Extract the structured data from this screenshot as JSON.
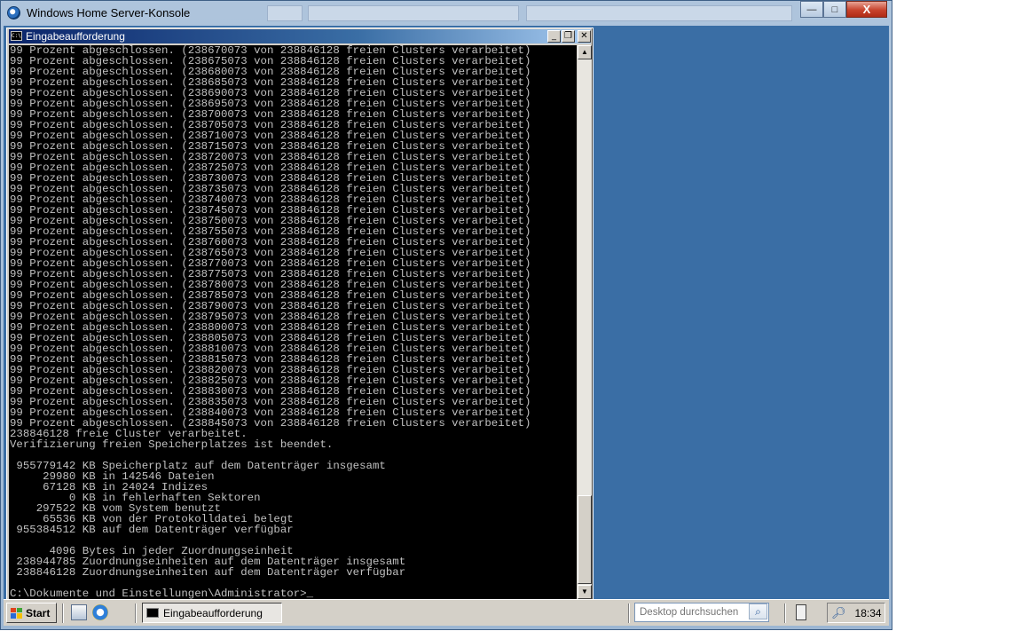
{
  "outer_window": {
    "title": "Windows Home Server-Konsole",
    "minimize_glyph": "—",
    "maximize_glyph": "□",
    "close_glyph": "X"
  },
  "cmd_window": {
    "title": "Eingabeaufforderung",
    "icon_text": "C:\\",
    "minimize_glyph": "_",
    "restore_glyph": "❐",
    "close_glyph": "✕"
  },
  "console": {
    "text": "99 Prozent abgeschlossen. (238670073 von 238846128 freien Clusters verarbeitet)\n99 Prozent abgeschlossen. (238675073 von 238846128 freien Clusters verarbeitet)\n99 Prozent abgeschlossen. (238680073 von 238846128 freien Clusters verarbeitet)\n99 Prozent abgeschlossen. (238685073 von 238846128 freien Clusters verarbeitet)\n99 Prozent abgeschlossen. (238690073 von 238846128 freien Clusters verarbeitet)\n99 Prozent abgeschlossen. (238695073 von 238846128 freien Clusters verarbeitet)\n99 Prozent abgeschlossen. (238700073 von 238846128 freien Clusters verarbeitet)\n99 Prozent abgeschlossen. (238705073 von 238846128 freien Clusters verarbeitet)\n99 Prozent abgeschlossen. (238710073 von 238846128 freien Clusters verarbeitet)\n99 Prozent abgeschlossen. (238715073 von 238846128 freien Clusters verarbeitet)\n99 Prozent abgeschlossen. (238720073 von 238846128 freien Clusters verarbeitet)\n99 Prozent abgeschlossen. (238725073 von 238846128 freien Clusters verarbeitet)\n99 Prozent abgeschlossen. (238730073 von 238846128 freien Clusters verarbeitet)\n99 Prozent abgeschlossen. (238735073 von 238846128 freien Clusters verarbeitet)\n99 Prozent abgeschlossen. (238740073 von 238846128 freien Clusters verarbeitet)\n99 Prozent abgeschlossen. (238745073 von 238846128 freien Clusters verarbeitet)\n99 Prozent abgeschlossen. (238750073 von 238846128 freien Clusters verarbeitet)\n99 Prozent abgeschlossen. (238755073 von 238846128 freien Clusters verarbeitet)\n99 Prozent abgeschlossen. (238760073 von 238846128 freien Clusters verarbeitet)\n99 Prozent abgeschlossen. (238765073 von 238846128 freien Clusters verarbeitet)\n99 Prozent abgeschlossen. (238770073 von 238846128 freien Clusters verarbeitet)\n99 Prozent abgeschlossen. (238775073 von 238846128 freien Clusters verarbeitet)\n99 Prozent abgeschlossen. (238780073 von 238846128 freien Clusters verarbeitet)\n99 Prozent abgeschlossen. (238785073 von 238846128 freien Clusters verarbeitet)\n99 Prozent abgeschlossen. (238790073 von 238846128 freien Clusters verarbeitet)\n99 Prozent abgeschlossen. (238795073 von 238846128 freien Clusters verarbeitet)\n99 Prozent abgeschlossen. (238800073 von 238846128 freien Clusters verarbeitet)\n99 Prozent abgeschlossen. (238805073 von 238846128 freien Clusters verarbeitet)\n99 Prozent abgeschlossen. (238810073 von 238846128 freien Clusters verarbeitet)\n99 Prozent abgeschlossen. (238815073 von 238846128 freien Clusters verarbeitet)\n99 Prozent abgeschlossen. (238820073 von 238846128 freien Clusters verarbeitet)\n99 Prozent abgeschlossen. (238825073 von 238846128 freien Clusters verarbeitet)\n99 Prozent abgeschlossen. (238830073 von 238846128 freien Clusters verarbeitet)\n99 Prozent abgeschlossen. (238835073 von 238846128 freien Clusters verarbeitet)\n99 Prozent abgeschlossen. (238840073 von 238846128 freien Clusters verarbeitet)\n99 Prozent abgeschlossen. (238845073 von 238846128 freien Clusters verarbeitet)\n238846128 freie Cluster verarbeitet.\nVerifizierung freien Speicherplatzes ist beendet.\n\n 955779142 KB Speicherplatz auf dem Datenträger insgesamt\n     29980 KB in 142546 Dateien\n     67128 KB in 24024 Indizes\n         0 KB in fehlerhaften Sektoren\n    297522 KB vom System benutzt\n     65536 KB von der Protokolldatei belegt\n 955384512 KB auf dem Datenträger verfügbar\n\n      4096 Bytes in jeder Zuordnungseinheit\n 238944785 Zuordnungseinheiten auf dem Datenträger insgesamt\n 238846128 Zuordnungseinheiten auf dem Datenträger verfügbar\n\nC:\\Dokumente und Einstellungen\\Administrator>_",
    "text_color": "#c0c0c0",
    "background": "#000000"
  },
  "scrollbar": {
    "up_glyph": "▲",
    "down_glyph": "▼",
    "position": 0.95
  },
  "taskbar": {
    "start_label": "Start",
    "task_label": "Eingabeaufforderung",
    "search_placeholder": "Desktop durchsuchen",
    "search_icon": "⌕",
    "clock": "18:34",
    "colors": {
      "desktop": "#3a6ea5",
      "taskbar": "#d4d0c8"
    }
  }
}
